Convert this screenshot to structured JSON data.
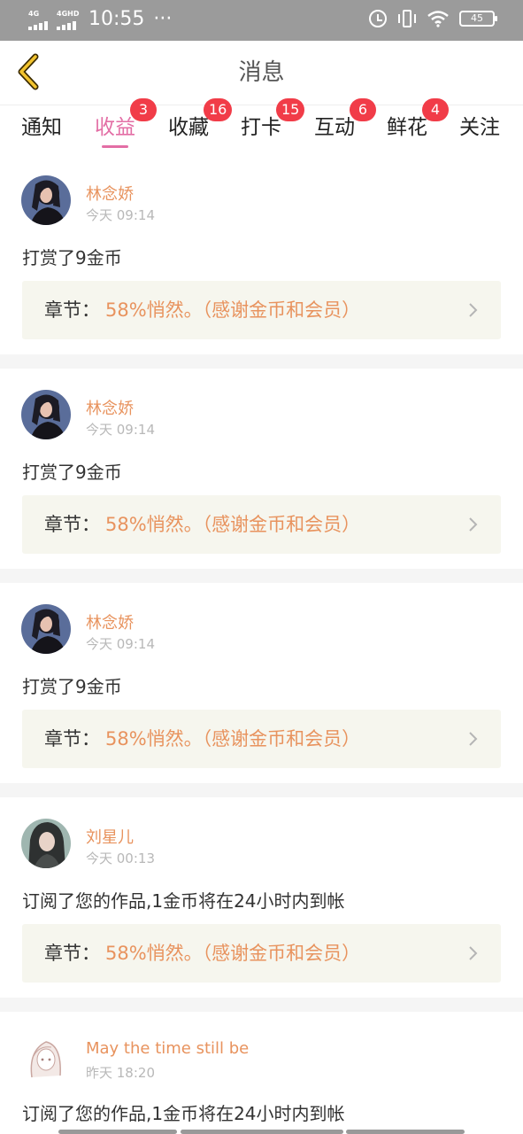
{
  "status_bar": {
    "signal_1": "4G",
    "signal_2": "4GHD",
    "time": "10:55",
    "dots": "···",
    "battery": "45",
    "icons": [
      "alarm-icon",
      "vibrate-icon",
      "wifi-icon",
      "battery-icon"
    ]
  },
  "header": {
    "title": "消息",
    "back_icon": "chevron-left-icon"
  },
  "tabs": [
    {
      "label": "通知",
      "badge": ""
    },
    {
      "label": "收益",
      "badge": "3"
    },
    {
      "label": "收藏",
      "badge": "16"
    },
    {
      "label": "打卡",
      "badge": "15"
    },
    {
      "label": "互动",
      "badge": "6"
    },
    {
      "label": "鲜花",
      "badge": "4"
    },
    {
      "label": "关注",
      "badge": ""
    }
  ],
  "active_tab": "收益",
  "feed": [
    {
      "user": "林念娇",
      "time": "今天 09:14",
      "message": "打赏了9金币",
      "chapter_label": "章节：",
      "chapter_title": "58%悄然。（感谢金币和会员）"
    },
    {
      "user": "林念娇",
      "time": "今天 09:14",
      "message": "打赏了9金币",
      "chapter_label": "章节：",
      "chapter_title": "58%悄然。（感谢金币和会员）"
    },
    {
      "user": "林念娇",
      "time": "今天 09:14",
      "message": "打赏了9金币",
      "chapter_label": "章节：",
      "chapter_title": "58%悄然。（感谢金币和会员）"
    },
    {
      "user": "刘星儿",
      "time": "今天 00:13",
      "message": "订阅了您的作品,1金币将在24小时内到帐",
      "chapter_label": "章节：",
      "chapter_title": "58%悄然。（感谢金币和会员）"
    },
    {
      "user": "May the time still be",
      "time": "昨天 18:20",
      "message": "订阅了您的作品,1金币将在24小时内到帐"
    }
  ],
  "colors": {
    "accent_pink": "#e36ea5",
    "badge_red": "#f13c48",
    "username_orange": "#e8935e",
    "back_arrow_yellow": "#f2c32e",
    "chapter_bg": "#f6f6ee"
  }
}
